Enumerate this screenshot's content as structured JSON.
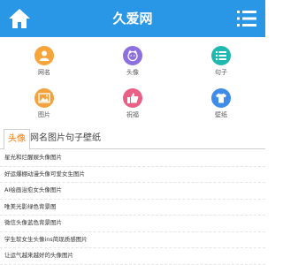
{
  "header": {
    "title": "久爱网"
  },
  "categories": [
    {
      "label": "网名",
      "color": "#f7a43a",
      "icon": "person-icon"
    },
    {
      "label": "头像",
      "color": "#8e6fe0",
      "icon": "avatar-icon"
    },
    {
      "label": "句子",
      "color": "#20b9b0",
      "icon": "list-icon"
    },
    {
      "label": "图片",
      "color": "#f3a23d",
      "icon": "picture-icon"
    },
    {
      "label": "祝福",
      "color": "#e95f86",
      "icon": "thumbs-up-icon"
    },
    {
      "label": "壁纸",
      "color": "#3e8ce8",
      "icon": "shirt-icon"
    }
  ],
  "tabs": [
    "头像",
    "网名",
    "图片",
    "句子",
    "壁纸"
  ],
  "active_tab": "头像",
  "articles": [
    "星光和烂醒娱头像图片",
    "好运爆棚动漫头像可爱女生图片",
    "AI绘画治愈女头像图片",
    "唯美光影绿色背景图",
    "微信头像蓝色背景图片",
    "学生软女生头像ins简现质感图片",
    "让运气越来越好的头像图片"
  ],
  "colors": {
    "header": "#2a96e6",
    "active_tab": "#ff7a00"
  }
}
